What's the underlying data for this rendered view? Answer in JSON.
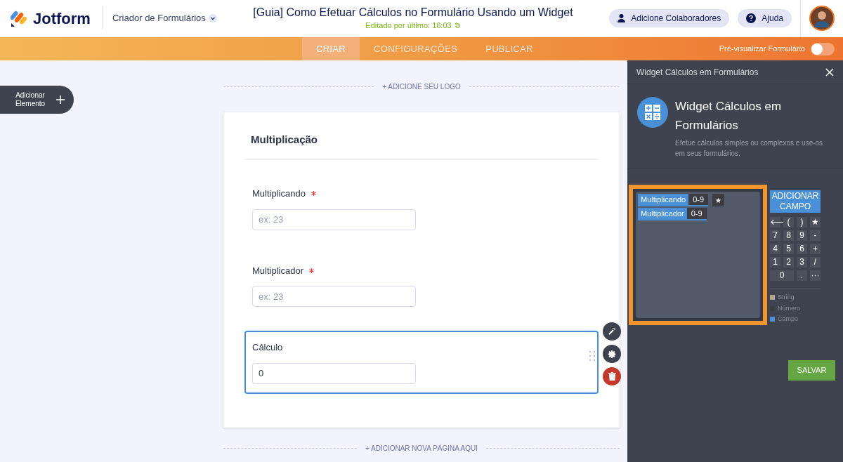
{
  "header": {
    "logo": "Jotform",
    "builder_menu": "Criador de Formulários",
    "title": "[Guia] Como Efetuar Cálculos no Formulário Usando um Widget",
    "edited": "Editado por último: 16:03",
    "buttons": [
      {
        "kind": "user",
        "label": "Adicione Colaboradores"
      },
      {
        "kind": "help",
        "label": "Ajuda"
      }
    ]
  },
  "tabs": [
    {
      "label": "CRIAR",
      "selected": true
    },
    {
      "label": "CONFIGURAÇÕES",
      "selected": false
    },
    {
      "label": "PUBLICAR",
      "selected": false
    }
  ],
  "preview": {
    "label": "Pré-visualizar Formulário",
    "on": false
  },
  "add_element": "Adicionar Elemento",
  "form": {
    "logo_link": "+ ADICIONE SEU LOGO",
    "heading": "Multiplicação",
    "fields": [
      {
        "label": "Multiplicando",
        "required": true,
        "placeholder": "ex: 23",
        "selected": false
      },
      {
        "label": "Multiplicador",
        "required": true,
        "placeholder": "ex: 23",
        "selected": false
      },
      {
        "label": "Cálculo",
        "required": false,
        "value": "0",
        "selected": true
      }
    ],
    "add_page": "+ ADICIONAR NOVA PÁGINA AQUI"
  },
  "panel": {
    "title": "Widget Cálculos em Formulários",
    "widget_name": "Widget Cálculos em Formulários",
    "description": "Efetue cálculos simples ou complexos e use-os em seus formulários.",
    "tokens": [
      {
        "kind": "field",
        "label": "Multiplicando",
        "range": "0-9"
      },
      {
        "kind": "operator",
        "label": "★"
      },
      {
        "kind": "field",
        "label": "Multiplicador",
        "range": "0-9"
      }
    ],
    "add_field": "ADICIONAR CAMPO",
    "keys": [
      "🡐",
      "(",
      ")",
      "★",
      "7",
      "8",
      "9",
      "-",
      "4",
      "5",
      "6",
      "+",
      "1",
      "2",
      "3",
      "/",
      "0",
      ".",
      "···"
    ],
    "legend": [
      {
        "label": "String",
        "color": "#b3a68b"
      },
      {
        "label": "Número",
        "color": "#3b3d42"
      },
      {
        "label": "Campo",
        "color": "#4a90d9"
      }
    ],
    "save": "SALVAR"
  }
}
